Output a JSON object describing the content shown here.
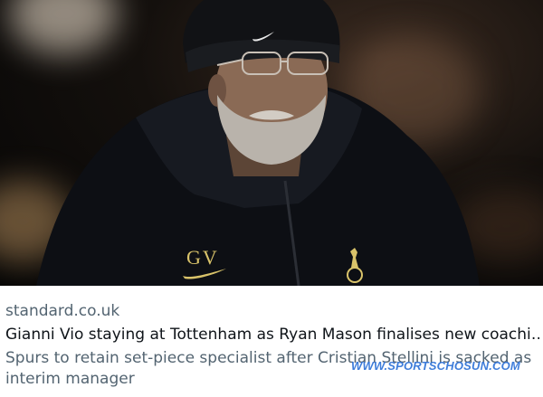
{
  "card": {
    "domain": "standard.co.uk",
    "headline": "Gianni Vio staying at Tottenham as Ryan Mason finalises new coachi…",
    "description": "Spurs to retain set-piece specialist after Cristian Stellini is sacked as interim manager"
  },
  "image": {
    "jacket_initials": "GV",
    "hat_logo": "nike-swoosh",
    "crest": "tottenham-cockerel"
  },
  "watermark": {
    "text": "WWW.SPORTSCHOSUN.COM"
  },
  "colors": {
    "secondary_text": "#536471",
    "primary_text": "#0f1419",
    "watermark": "#2a6fd6"
  }
}
